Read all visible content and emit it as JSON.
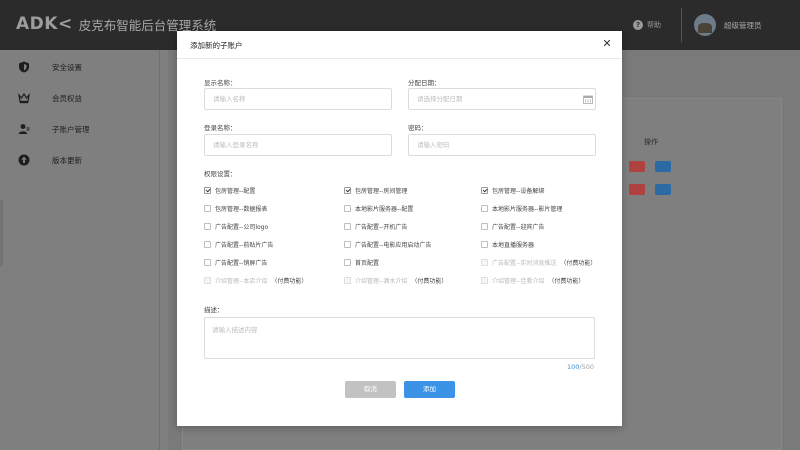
{
  "header": {
    "logo_mark": "ADK",
    "app_title": "皮克布智能后台管理系统",
    "help_label": "帮助",
    "username": "超级管理员"
  },
  "sidebar": {
    "items": [
      {
        "label": "安全设置",
        "icon": "shield-icon"
      },
      {
        "label": "会员权益",
        "icon": "crown-icon"
      },
      {
        "label": "子账户管理",
        "icon": "users-icon"
      },
      {
        "label": "版本更新",
        "icon": "upload-icon"
      }
    ]
  },
  "background": {
    "column_header": "操作"
  },
  "modal": {
    "title": "添加新的子账户",
    "fields": {
      "display_name": {
        "label": "显示名称：",
        "placeholder": "请输入名称",
        "value": ""
      },
      "assign_date": {
        "label": "分配日期：",
        "placeholder": "请选择分配日期",
        "value": ""
      },
      "login_name": {
        "label": "登录名称：",
        "placeholder": "请输入登录名称",
        "value": ""
      },
      "password": {
        "label": "密码：",
        "placeholder": "请输入密码",
        "value": ""
      }
    },
    "permissions_label": "权限设置：",
    "permissions": [
      {
        "label": "包房管理--配置",
        "checked": true,
        "disabled": false,
        "paid": ""
      },
      {
        "label": "包房管理--房间管理",
        "checked": true,
        "disabled": false,
        "paid": ""
      },
      {
        "label": "包房管理--设备解绑",
        "checked": true,
        "disabled": false,
        "paid": ""
      },
      {
        "label": "包房管理--数据报表",
        "checked": false,
        "disabled": false,
        "paid": ""
      },
      {
        "label": "本地影片服务器--配置",
        "checked": false,
        "disabled": false,
        "paid": ""
      },
      {
        "label": "本地影片服务器--影片管理",
        "checked": false,
        "disabled": false,
        "paid": ""
      },
      {
        "label": "广告配置--公司logo",
        "checked": false,
        "disabled": false,
        "paid": ""
      },
      {
        "label": "广告配置--开机广告",
        "checked": false,
        "disabled": false,
        "paid": ""
      },
      {
        "label": "广告配置--迎宾广告",
        "checked": false,
        "disabled": false,
        "paid": ""
      },
      {
        "label": "广告配置--前贴片广告",
        "checked": false,
        "disabled": false,
        "paid": ""
      },
      {
        "label": "广告配置--电影应用启动广告",
        "checked": false,
        "disabled": false,
        "paid": ""
      },
      {
        "label": "本地直播服务器",
        "checked": false,
        "disabled": false,
        "paid": ""
      },
      {
        "label": "广告配置--销屏广告",
        "checked": false,
        "disabled": false,
        "paid": ""
      },
      {
        "label": "首页配置",
        "checked": false,
        "disabled": false,
        "paid": ""
      },
      {
        "label": "广告配置--实时消息推送",
        "checked": false,
        "disabled": true,
        "paid": "（付费功能）"
      },
      {
        "label": "介绍管理--本店介绍",
        "checked": false,
        "disabled": true,
        "paid": "（付费功能）"
      },
      {
        "label": "介绍管理--酒水介绍",
        "checked": false,
        "disabled": true,
        "paid": "（付费功能）"
      },
      {
        "label": "介绍管理--佳肴介绍",
        "checked": false,
        "disabled": true,
        "paid": "（付费功能）"
      }
    ],
    "description": {
      "label": "描述：",
      "placeholder": "请输入描述内容",
      "value": "",
      "count": "100",
      "max": "/500"
    },
    "buttons": {
      "cancel": "取消",
      "confirm": "添加"
    }
  },
  "colors": {
    "primary": "#3b93e6",
    "cancel": "#c2c2c2",
    "topbar": "#2b2b2b",
    "danger_mini": "#b94a48",
    "info_mini": "#2c6aa6"
  }
}
